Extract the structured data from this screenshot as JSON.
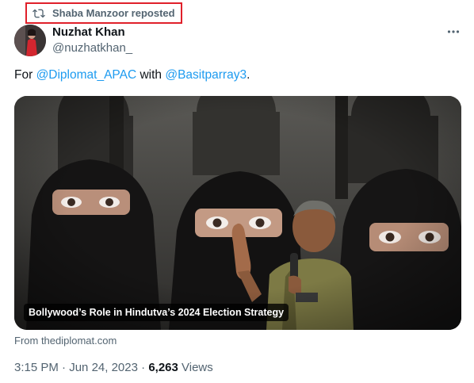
{
  "repost": {
    "label": "Shaba Manzoor reposted",
    "icon": "repost-icon"
  },
  "author": {
    "name": "Nuzhat Khan",
    "handle": "@nuzhatkhan_"
  },
  "tweet": {
    "prefix": "For ",
    "mention1": "@Diplomat_APAC",
    "middle": " with ",
    "mention2": "@Basitparray3",
    "suffix": "."
  },
  "card": {
    "title": "Bollywood’s Role in Hindutva’s 2024 Election Strategy",
    "source": "From thediplomat.com"
  },
  "meta": {
    "time": "3:15 PM",
    "separator1": " · ",
    "date": "Jun 24, 2023",
    "separator2": " · ",
    "views_count": "6,263",
    "views_label": " Views"
  },
  "colors": {
    "link": "#1d9bf0",
    "highlight_border": "#e0202a",
    "secondary_text": "#536471"
  }
}
